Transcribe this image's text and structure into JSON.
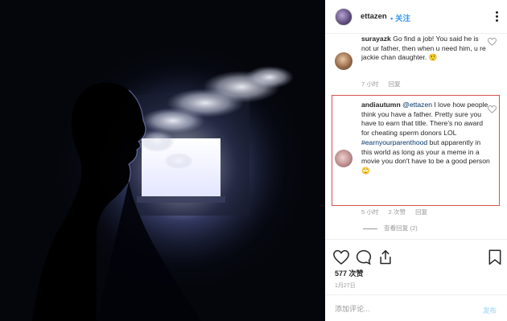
{
  "post": {
    "username": "ettazen",
    "separator": "•",
    "follow_label": "关注",
    "likes_text": "577 次赞",
    "date_text": "1月27日",
    "add_comment_placeholder": "添加评论...",
    "post_label": "发布"
  },
  "comments": [
    {
      "username": "surayazk",
      "text": "Go find a job! You said he is not ur father, then when u need him, u re jackie chan daughter. 🤨",
      "time": "7 小时",
      "reply_label": "回复"
    },
    {
      "username": "andiautumn",
      "mention": "@ettazen",
      "text_before_hashtag": "I love how people think you have a father. Pretty sure you have to earn that title. There's no award for cheating sperm donors LOL",
      "hashtag": "#earnyourparenthood",
      "text_after_hashtag": "but apparently in this world as long as your a meme in a movie you don't have to be a good person 🙄",
      "time": "5 小时",
      "likes": "2 次赞",
      "reply_label": "回复"
    }
  ],
  "view_replies": "查看回复 (2)",
  "icons": {
    "more": "more-options-icon",
    "heart": "heart-icon",
    "comment": "comment-icon",
    "share": "share-icon",
    "bookmark": "bookmark-icon"
  },
  "colors": {
    "link": "#3897f0",
    "highlight": "#d9534f",
    "muted": "#999999"
  }
}
